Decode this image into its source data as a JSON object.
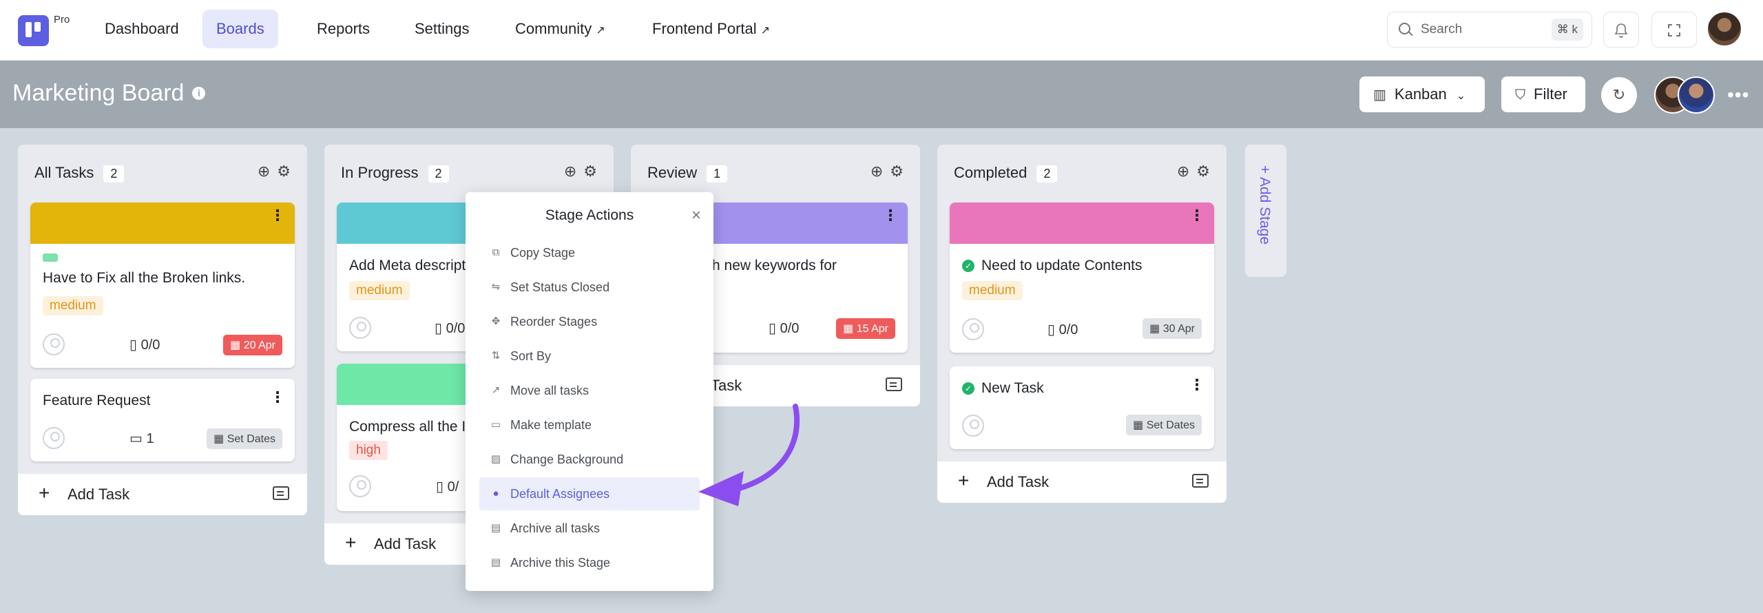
{
  "nav": {
    "pro_label": "Pro",
    "items": [
      {
        "label": "Dashboard"
      },
      {
        "label": "Boards"
      },
      {
        "label": "Reports"
      },
      {
        "label": "Settings"
      },
      {
        "label": "Community",
        "ext": "↗"
      },
      {
        "label": "Frontend Portal",
        "ext": "↗"
      }
    ],
    "search": {
      "placeholder": "Search",
      "shortcut": "⌘ k"
    }
  },
  "board": {
    "title": "Marketing Board",
    "view_label": "Kanban",
    "filter_label": "Filter"
  },
  "stages": [
    {
      "name": "All Tasks",
      "count": "2"
    },
    {
      "name": "In Progress",
      "count": "2"
    },
    {
      "name": "Review",
      "count": "1"
    },
    {
      "name": "Completed",
      "count": "2"
    }
  ],
  "cards": {
    "c1": {
      "title": "Have to Fix all the Broken links.",
      "priority": "medium",
      "subtasks": "0/0",
      "date": "20 Apr"
    },
    "c2": {
      "title": "Feature Request",
      "comments": "1",
      "date": "Set Dates"
    },
    "c3": {
      "title": "Add Meta descript",
      "priority": "medium",
      "subtasks": "0/0"
    },
    "c4": {
      "title": "Compress all the Ir",
      "priority": "high",
      "subtasks": "0/"
    },
    "c5": {
      "title": "h new keywords for",
      "subtasks": "0/0",
      "date": "15 Apr"
    },
    "c6": {
      "title": "Need to update Contents",
      "priority": "medium",
      "subtasks": "0/0",
      "date": "30 Apr"
    },
    "c7": {
      "title": "New Task",
      "date": "Set Dates"
    }
  },
  "add_task_label": "Add Task",
  "add_task_review_label": "Task",
  "add_stage_label": "+ Add Stage",
  "stage_actions": {
    "title": "Stage Actions",
    "items": [
      {
        "label": "Copy Stage",
        "icon": "copy-icon"
      },
      {
        "label": "Set Status Closed",
        "icon": "status-icon"
      },
      {
        "label": "Reorder Stages",
        "icon": "move-icon"
      },
      {
        "label": "Sort By",
        "icon": "sort-icon"
      },
      {
        "label": "Move all tasks",
        "icon": "arrow-icon"
      },
      {
        "label": "Make template",
        "icon": "template-icon"
      },
      {
        "label": "Change Background",
        "icon": "image-icon"
      },
      {
        "label": "Default Assignees",
        "icon": "user-icon"
      },
      {
        "label": "Archive all tasks",
        "icon": "archive-icon"
      },
      {
        "label": "Archive this Stage",
        "icon": "archive-icon"
      }
    ]
  },
  "colors": {
    "accent": "#5b5fe0",
    "cover_yellow": "#e3b40a",
    "cover_teal": "#5fc9d3",
    "cover_green": "#6ee7a7",
    "cover_purple": "#a391ee",
    "cover_pink": "#e975bb",
    "annotation_arrow": "#8b4cf0"
  }
}
